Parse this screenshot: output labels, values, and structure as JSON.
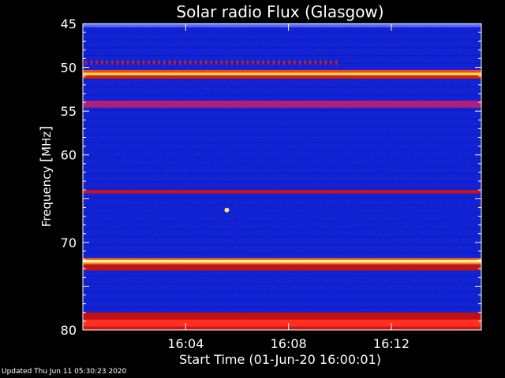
{
  "chart_data": {
    "type": "heatmap",
    "title": "Solar radio Flux (Glasgow)",
    "xlabel": "Start Time (01-Jun-20 16:00:01)",
    "ylabel_text": "Frequency ",
    "ylabel_unit": "MHz",
    "x_range_minutes": [
      0,
      15.5
    ],
    "x_ticks": [
      {
        "minute": 4,
        "label": "16:04"
      },
      {
        "minute": 8,
        "label": "16:08"
      },
      {
        "minute": 12,
        "label": "16:12"
      }
    ],
    "ylim": [
      45,
      80
    ],
    "y_ticks": [
      {
        "mhz": 45,
        "label": "45"
      },
      {
        "mhz": 50,
        "label": "50"
      },
      {
        "mhz": 55,
        "label": "55"
      },
      {
        "mhz": 60,
        "label": "60"
      },
      {
        "mhz": 70,
        "label": "70"
      },
      {
        "mhz": 80,
        "label": "80"
      }
    ],
    "y_axis_inverted": true,
    "background_color": "#1428dc",
    "bands": [
      {
        "mhz_from": 45.0,
        "mhz_to": 45.4,
        "color": "#5a6cff"
      },
      {
        "mhz_from": 49.2,
        "mhz_to": 49.7,
        "color": "#c81e1e",
        "dashed_until_minute": 10
      },
      {
        "mhz_from": 50.3,
        "mhz_to": 50.6,
        "color": "#ff4020"
      },
      {
        "mhz_from": 50.6,
        "mhz_to": 50.9,
        "color": "#ffe040"
      },
      {
        "mhz_from": 50.9,
        "mhz_to": 51.3,
        "color": "#d02010"
      },
      {
        "mhz_from": 53.8,
        "mhz_to": 54.6,
        "color": "#b0207a"
      },
      {
        "mhz_from": 64.0,
        "mhz_to": 64.4,
        "color": "#c8141e"
      },
      {
        "mhz_from": 71.8,
        "mhz_to": 72.0,
        "color": "#ff6a20"
      },
      {
        "mhz_from": 72.0,
        "mhz_to": 72.3,
        "color": "#ffff90"
      },
      {
        "mhz_from": 72.3,
        "mhz_to": 72.5,
        "color": "#ff8a20"
      },
      {
        "mhz_from": 72.5,
        "mhz_to": 73.2,
        "color": "#c01818"
      },
      {
        "mhz_from": 78.0,
        "mhz_to": 78.8,
        "color": "#c01010"
      },
      {
        "mhz_from": 78.8,
        "mhz_to": 79.6,
        "color": "#ff3020"
      },
      {
        "mhz_from": 79.6,
        "mhz_to": 80.0,
        "color": "#d01818"
      }
    ],
    "spots": [
      {
        "minute": 5.6,
        "mhz": 66.3,
        "color": "#ffe060"
      }
    ]
  },
  "footer": {
    "updated": "Updated Thu Jun 11 05:30:23 2020"
  }
}
